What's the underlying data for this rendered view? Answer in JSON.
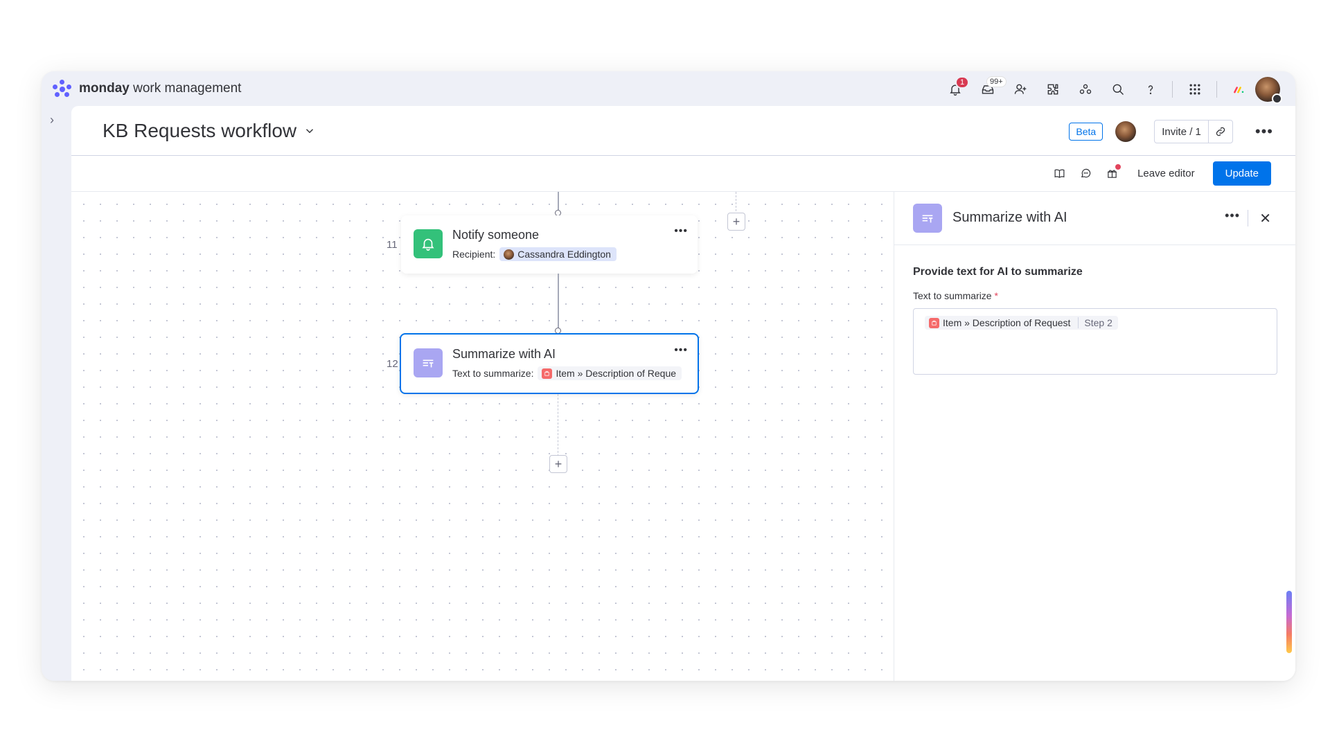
{
  "app": {
    "brand_bold": "monday",
    "brand_rest": " work management"
  },
  "topbar": {
    "notifications_count": "1",
    "inbox_count": "99+",
    "icons": [
      "bell-icon",
      "inbox-icon",
      "invite-member-icon",
      "integrations-icon",
      "marketplace-icon",
      "search-icon",
      "help-icon",
      "apps-grid-icon",
      "product-switcher-icon",
      "user-avatar"
    ]
  },
  "header": {
    "board_title": "KB Requests workflow",
    "beta_label": "Beta",
    "invite_label": "Invite / 1"
  },
  "toolbar": {
    "leave_editor_label": "Leave editor",
    "update_label": "Update"
  },
  "canvas": {
    "steps": [
      {
        "number": "11",
        "title": "Notify someone",
        "field_label": "Recipient:",
        "value": "Cassandra Eddington",
        "icon": "bell-icon",
        "icon_color": "#33c17a"
      },
      {
        "number": "12",
        "title": "Summarize with AI",
        "field_label": "Text to summarize:",
        "value": "Item » Description of Reque",
        "icon": "ai-summarize-icon",
        "icon_color": "#a9a6f2",
        "selected": true
      }
    ]
  },
  "panel": {
    "title": "Summarize with AI",
    "section_title": "Provide text for AI to summarize",
    "field_label": "Text to summarize",
    "required_mark": "*",
    "field_value": "Item » Description of Request",
    "field_step": "Step 2"
  },
  "colors": {
    "accent": "#0073ea",
    "notify_green": "#33c17a",
    "ai_purple": "#a9a6f2",
    "item_red": "#f56a6a"
  }
}
